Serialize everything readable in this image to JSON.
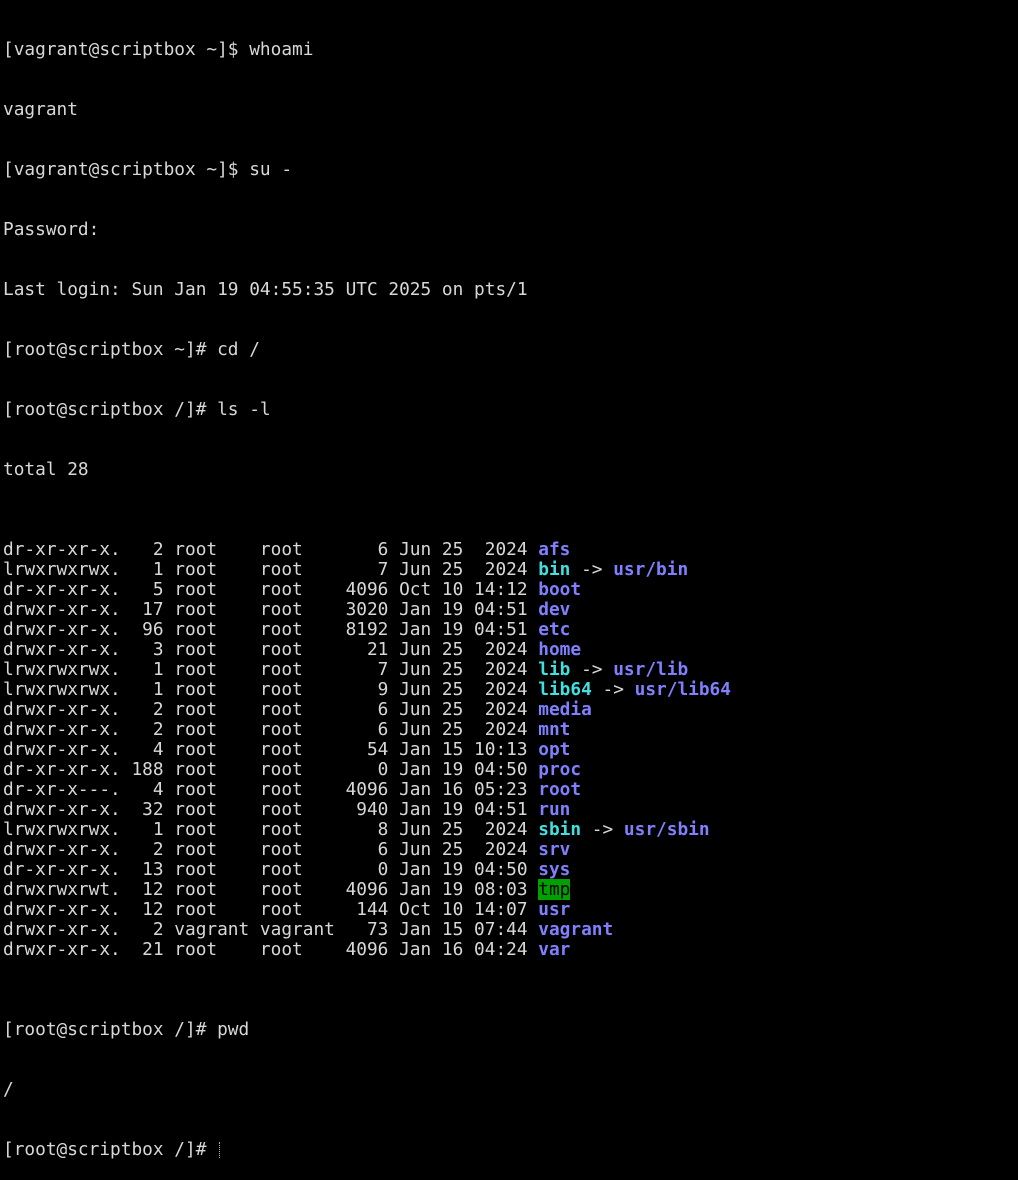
{
  "session": {
    "line_top_cut": "[vagrant@scriptbox ~]$ whoami",
    "whoami_output": "vagrant",
    "su_cmd": "[vagrant@scriptbox ~]$ su -",
    "password_prompt": "Password:",
    "last_login": "Last login: Sun Jan 19 04:55:35 UTC 2025 on pts/1",
    "cd_cmd": "[root@scriptbox ~]# cd /",
    "ls_cmd": "[root@scriptbox /]# ls -l",
    "total": "total 28",
    "pwd_cmd": "[root@scriptbox /]# pwd",
    "pwd_output": "/",
    "final_prompt": "[root@scriptbox /]# "
  },
  "listing": [
    {
      "meta": "dr-xr-xr-x.   2 root    root       6 Jun 25  2024 ",
      "name": "afs",
      "kind": "dir"
    },
    {
      "meta": "lrwxrwxrwx.   1 root    root       7 Jun 25  2024 ",
      "name": "bin",
      "kind": "link",
      "target": "usr/bin"
    },
    {
      "meta": "dr-xr-xr-x.   5 root    root    4096 Oct 10 14:12 ",
      "name": "boot",
      "kind": "dir"
    },
    {
      "meta": "drwxr-xr-x.  17 root    root    3020 Jan 19 04:51 ",
      "name": "dev",
      "kind": "dir"
    },
    {
      "meta": "drwxr-xr-x.  96 root    root    8192 Jan 19 04:51 ",
      "name": "etc",
      "kind": "dir"
    },
    {
      "meta": "drwxr-xr-x.   3 root    root      21 Jun 25  2024 ",
      "name": "home",
      "kind": "dir"
    },
    {
      "meta": "lrwxrwxrwx.   1 root    root       7 Jun 25  2024 ",
      "name": "lib",
      "kind": "link",
      "target": "usr/lib"
    },
    {
      "meta": "lrwxrwxrwx.   1 root    root       9 Jun 25  2024 ",
      "name": "lib64",
      "kind": "link",
      "target": "usr/lib64"
    },
    {
      "meta": "drwxr-xr-x.   2 root    root       6 Jun 25  2024 ",
      "name": "media",
      "kind": "dir"
    },
    {
      "meta": "drwxr-xr-x.   2 root    root       6 Jun 25  2024 ",
      "name": "mnt",
      "kind": "dir"
    },
    {
      "meta": "drwxr-xr-x.   4 root    root      54 Jan 15 10:13 ",
      "name": "opt",
      "kind": "dir"
    },
    {
      "meta": "dr-xr-xr-x. 188 root    root       0 Jan 19 04:50 ",
      "name": "proc",
      "kind": "dir"
    },
    {
      "meta": "dr-xr-x---.   4 root    root    4096 Jan 16 05:23 ",
      "name": "root",
      "kind": "dir"
    },
    {
      "meta": "drwxr-xr-x.  32 root    root     940 Jan 19 04:51 ",
      "name": "run",
      "kind": "dir"
    },
    {
      "meta": "lrwxrwxrwx.   1 root    root       8 Jun 25  2024 ",
      "name": "sbin",
      "kind": "link",
      "target": "usr/sbin"
    },
    {
      "meta": "drwxr-xr-x.   2 root    root       6 Jun 25  2024 ",
      "name": "srv",
      "kind": "dir"
    },
    {
      "meta": "dr-xr-xr-x.  13 root    root       0 Jan 19 04:50 ",
      "name": "sys",
      "kind": "dir"
    },
    {
      "meta": "drwxrwxrwt.  12 root    root    4096 Jan 19 08:03 ",
      "name": "tmp",
      "kind": "sticky"
    },
    {
      "meta": "drwxr-xr-x.  12 root    root     144 Oct 10 14:07 ",
      "name": "usr",
      "kind": "dir"
    },
    {
      "meta": "drwxr-xr-x.   2 vagrant vagrant   73 Jan 15 07:44 ",
      "name": "vagrant",
      "kind": "dir"
    },
    {
      "meta": "drwxr-xr-x.  21 root    root    4096 Jan 16 04:24 ",
      "name": "var",
      "kind": "dir"
    }
  ],
  "arrow": " -> ",
  "colors": {
    "background": "#000000",
    "text": "#d8d8d8",
    "directory": "#8080ff",
    "symlink": "#40e0e0",
    "sticky_bg": "#00a000"
  }
}
